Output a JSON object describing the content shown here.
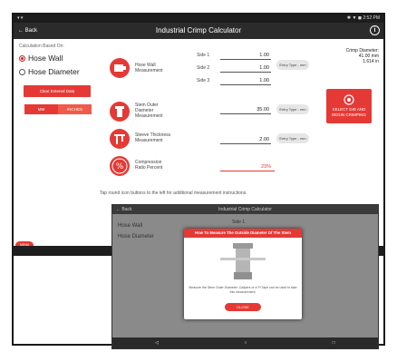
{
  "status": {
    "left": "▾ ▾",
    "right": "✱ ▼ ◼ 2:52 PM"
  },
  "appbar": {
    "back": "← Back",
    "title": "Industrial Crimp Calculator",
    "info": "i"
  },
  "left": {
    "calc_label": "Calculation Based On:",
    "option_wall": "Hose Wall",
    "option_diameter": "Hose Diameter",
    "clear_button": "Clear Entered Data",
    "unit_mm": "MM",
    "unit_inches": "INCHES"
  },
  "measurements": {
    "hose_wall": "Hose Wall\nMeasurement",
    "stem_od": "Stem Outer\nDiameter\nMeasurement",
    "sleeve": "Sleeve Thickness\nMeasurement",
    "compression": "Compression\nRatio Percent"
  },
  "sides": [
    {
      "label": "Side 1",
      "value": "1.00"
    },
    {
      "label": "Side 2",
      "value": "1.00"
    },
    {
      "label": "Side 3",
      "value": "1.00"
    }
  ],
  "stem_value": "35.00",
  "sleeve_value": "2.00",
  "compression_value": "23%",
  "entry_type": "Entry Type - mm",
  "crimp": {
    "title": "Crimp Diameter:",
    "mm": "41.00 mm",
    "in": "1.614 in"
  },
  "select_die": "SELECT DIE AND BEGIN CRIMPING",
  "tap_text": "Tap round icon buttons to the left for additional measurement instructions.",
  "menu": "MENU",
  "inset": {
    "back": "← Back",
    "title": "Industrial Crimp Calculator",
    "modal_title": "How To Measure The Outside Diameter Of The Stem",
    "modal_text": "Measure the Stem Outer Diameter. Calipers or a Pi Tape can be used to take this measurement.",
    "close": "CLOSE",
    "hose_wall": "Hose Wall",
    "hose_diameter": "Hose Diameter",
    "side1": "Side 1",
    "nav": [
      "◁",
      "○",
      "□"
    ]
  },
  "colors": {
    "accent": "#e53935",
    "appbar": "#2b2b2b"
  }
}
